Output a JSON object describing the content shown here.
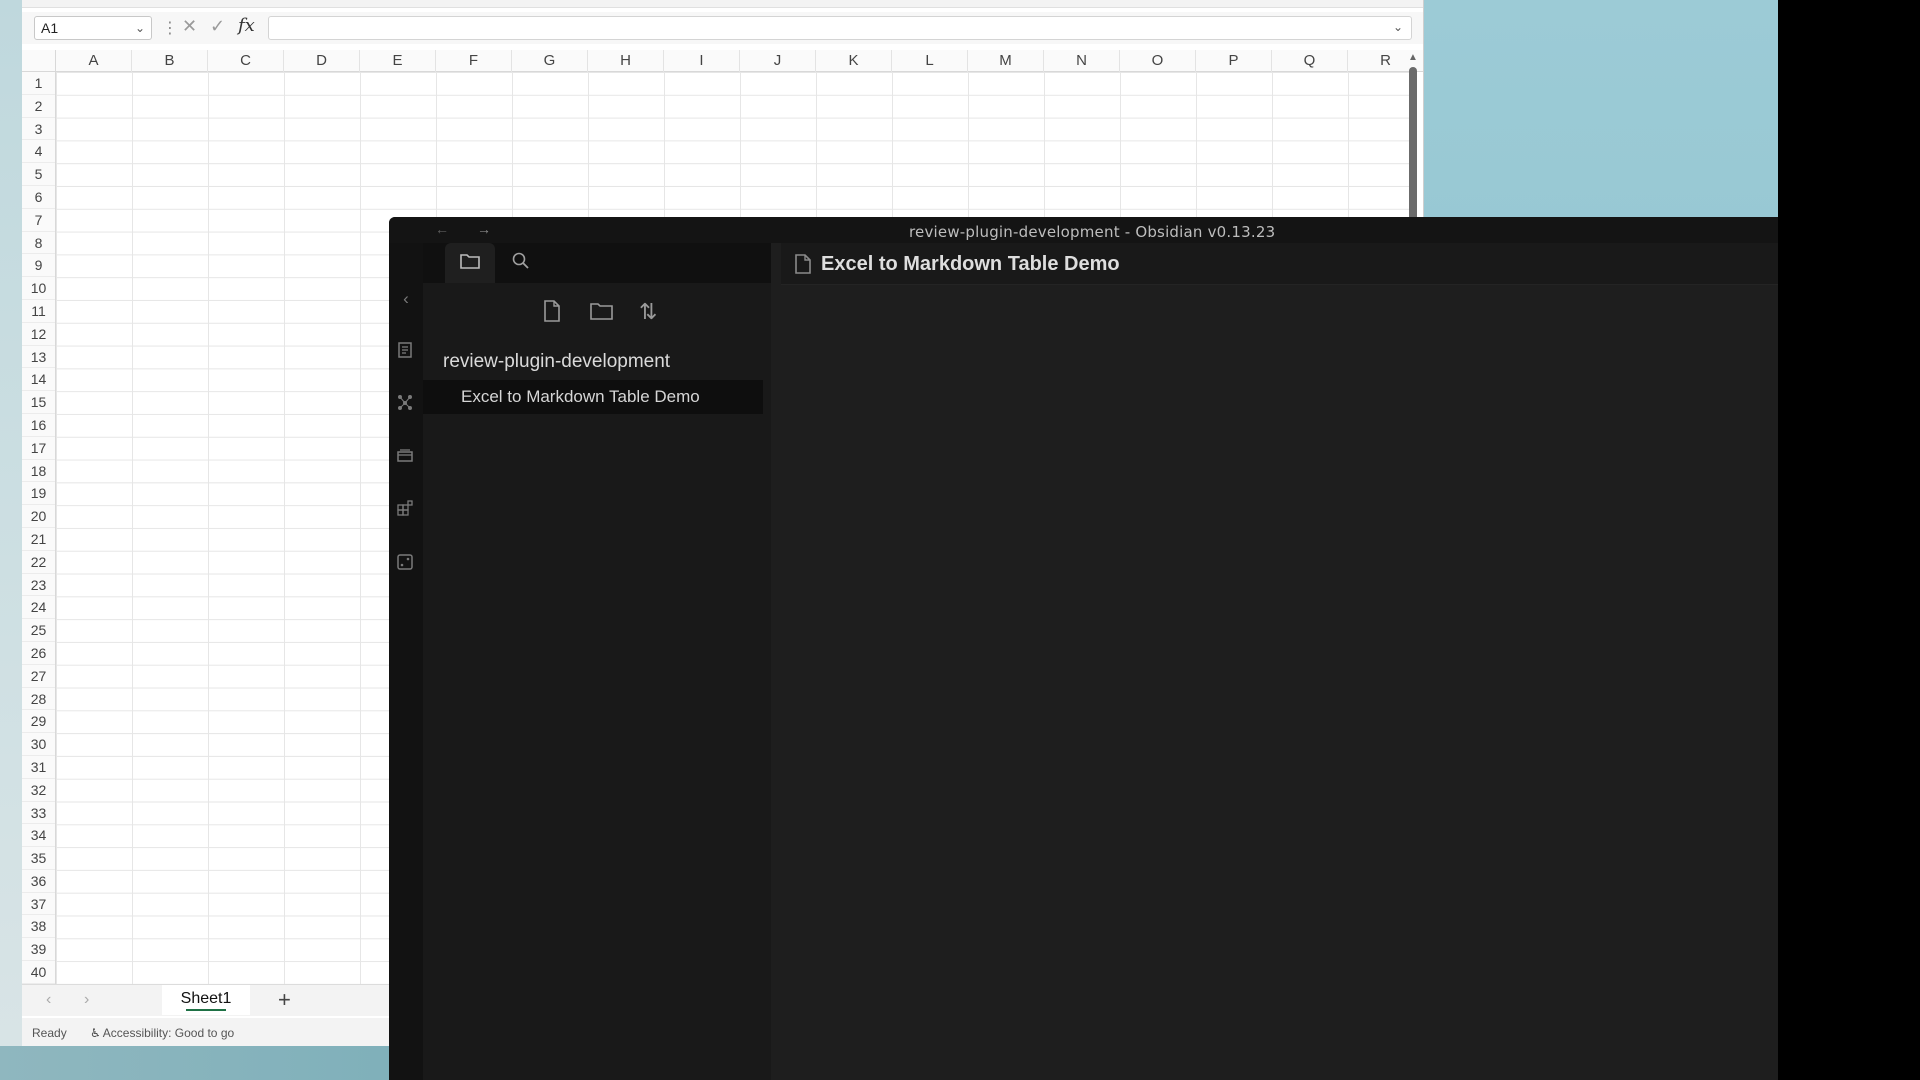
{
  "excel": {
    "name_box": "A1",
    "formula_fx": "fx",
    "columns": [
      "A",
      "B",
      "C",
      "D",
      "E",
      "F",
      "G",
      "H",
      "I",
      "J",
      "K",
      "L",
      "M",
      "N",
      "O",
      "P",
      "Q",
      "R"
    ],
    "rows": [
      "1",
      "2",
      "3",
      "4",
      "5",
      "6",
      "7",
      "8",
      "9",
      "10",
      "11",
      "12",
      "13",
      "14",
      "15",
      "16",
      "17",
      "18",
      "19",
      "20",
      "21",
      "22",
      "23",
      "24",
      "25",
      "26",
      "27",
      "28",
      "29",
      "30",
      "31",
      "32",
      "33",
      "34",
      "35",
      "36",
      "37",
      "38",
      "39",
      "40"
    ],
    "sheet_tab": "Sheet1",
    "add_sheet": "+",
    "status_ready": "Ready",
    "status_accessibility": "Accessibility: Good to go"
  },
  "obsidian": {
    "window_title": "review-plugin-development - Obsidian v0.13.23",
    "vault_name": "review-plugin-development",
    "file_item": "Excel to Markdown Table Demo",
    "note_title": "Excel to Markdown Table Demo",
    "nav_back": "←",
    "nav_forward": "→",
    "sort_glyph": "⇅"
  },
  "icons": {
    "ribbon": [
      "collapse-sidebar-icon",
      "open-quick-switcher-icon",
      "graph-view-icon",
      "open-today-icon",
      "insert-template-icon",
      "random-note-icon"
    ]
  },
  "colors": {
    "excel_accent": "#1e7145",
    "obsidian_bg": "#1e1e1e",
    "desktop": "#9ccbd6"
  }
}
